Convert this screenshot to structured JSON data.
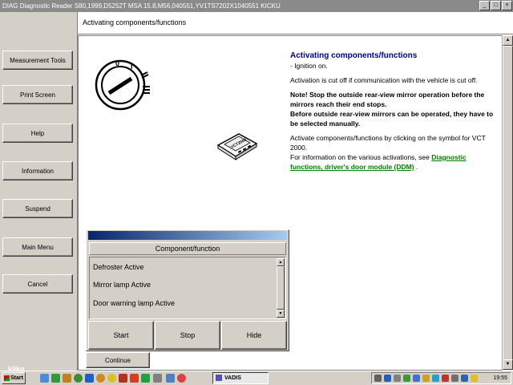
{
  "window": {
    "title": "DIAG Diagnostic Reader S80,1999,D5252T MSA 15.8,M56,040551,YV1TS7202X1040551 KICKU",
    "controls": [
      "_",
      "□",
      "×"
    ]
  },
  "sidebar": {
    "items": [
      {
        "label": "Measurement Tools"
      },
      {
        "label": "Print Screen"
      },
      {
        "label": "Help"
      },
      {
        "label": "Information"
      },
      {
        "label": "Suspend"
      },
      {
        "label": "Main Menu"
      },
      {
        "label": "Cancel"
      }
    ]
  },
  "header": {
    "title": "Activating components/functions"
  },
  "info": {
    "title": "Activating components/functions",
    "bullet": "-  Ignition on.",
    "para1": "Activation is cut off if communication with the vehicle is cut off.",
    "warning": "Note! Stop the outside rear-view mirror operation before the mirrors reach their end stops.",
    "warning2": "Before outside rear-view mirrors can be operated, they have to be selected manually.",
    "para2": "Activate components/functions by clicking on the symbol for VCT 2000.",
    "para3_prefix": "For information on the various activations, see ",
    "link": "Diagnostic functions, driver's door module (DDM)",
    "para3_suffix": " ."
  },
  "vct_label": "VCT2000",
  "dialog": {
    "header": "Component/function",
    "items": [
      "Defroster Active",
      "Mirror lamp Active",
      "Door warning lamp Active"
    ],
    "buttons": {
      "start": "Start",
      "stop": "Stop",
      "hide": "Hide"
    }
  },
  "continue_label": "Continue",
  "taskbar": {
    "start_label": "Start",
    "task_label": "VADIS",
    "clock": "19:55"
  },
  "watermark": "klikp"
}
